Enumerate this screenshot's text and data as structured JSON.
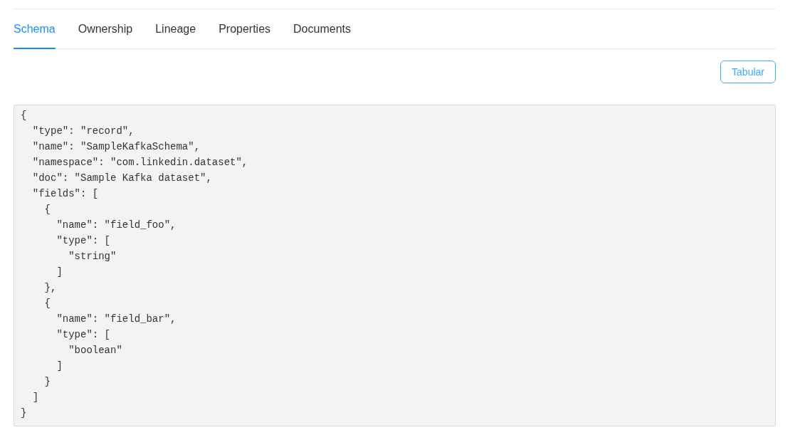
{
  "tabs": [
    {
      "label": "Schema",
      "selected": true
    },
    {
      "label": "Ownership",
      "selected": false
    },
    {
      "label": "Lineage",
      "selected": false
    },
    {
      "label": "Properties",
      "selected": false
    },
    {
      "label": "Documents",
      "selected": false
    }
  ],
  "view_toggle": {
    "label": "Tabular"
  },
  "schema_code": "{\n  \"type\": \"record\",\n  \"name\": \"SampleKafkaSchema\",\n  \"namespace\": \"com.linkedin.dataset\",\n  \"doc\": \"Sample Kafka dataset\",\n  \"fields\": [\n    {\n      \"name\": \"field_foo\",\n      \"type\": [\n        \"string\"\n      ]\n    },\n    {\n      \"name\": \"field_bar\",\n      \"type\": [\n        \"boolean\"\n      ]\n    }\n  ]\n}"
}
